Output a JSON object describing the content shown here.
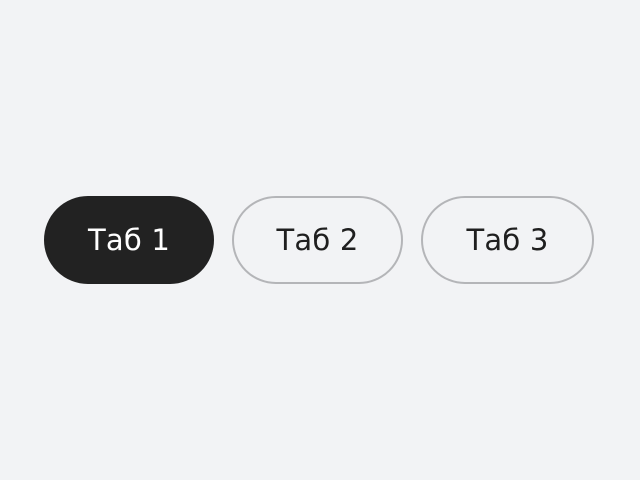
{
  "tabs": {
    "active_index": 0,
    "items": [
      {
        "label": "Таб 1",
        "state": "active"
      },
      {
        "label": "Таб 2",
        "state": "inactive"
      },
      {
        "label": "Таб 3",
        "state": "inactive"
      }
    ]
  },
  "colors": {
    "background": "#F2F3F5",
    "active_fill": "#222222",
    "active_text": "#FFFFFF",
    "inactive_border": "#B4B5B8",
    "inactive_text": "#1F1F1F"
  }
}
